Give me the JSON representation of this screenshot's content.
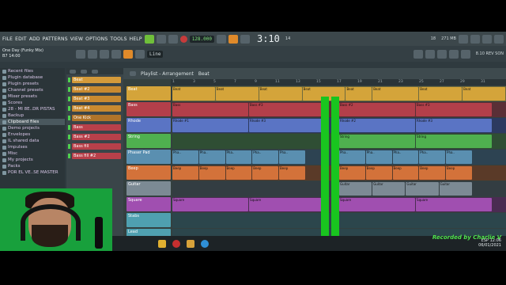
{
  "menu": [
    "FILE",
    "EDIT",
    "ADD",
    "PATTERNS",
    "VIEW",
    "OPTIONS",
    "TOOLS",
    "HELP"
  ],
  "transport": {
    "bpm": "128.000",
    "time": "3:10",
    "time_sub": "14",
    "cpu": "271 MB",
    "cpu2": "18"
  },
  "song": {
    "title": "One Day (Funky Mix)",
    "sub": "B7 14:00"
  },
  "toolbar": {
    "snap": "Line",
    "hint_label": "8.10 REV SON"
  },
  "browser": {
    "items": [
      {
        "label": "Recent files",
        "hl": false
      },
      {
        "label": "Plugin database",
        "hl": false
      },
      {
        "label": "Plugin presets",
        "hl": false
      },
      {
        "label": "Channel presets",
        "hl": false
      },
      {
        "label": "Mixer presets",
        "hl": false
      },
      {
        "label": "Scores",
        "hl": false
      },
      {
        "label": "28 - MI 8E..DR PISTAS",
        "hl": false
      },
      {
        "label": "Backup",
        "hl": false
      },
      {
        "label": "Clipboard files",
        "hl": true
      },
      {
        "label": "Demo projects",
        "hl": false
      },
      {
        "label": "Envelopes",
        "hl": false
      },
      {
        "label": "IL shared data",
        "hl": false
      },
      {
        "label": "Impulses",
        "hl": false
      },
      {
        "label": "Misc",
        "hl": false
      },
      {
        "label": "My projects",
        "hl": false
      },
      {
        "label": "Packs",
        "hl": false
      },
      {
        "label": "POR EL VE..SE MASTER",
        "hl": false
      }
    ]
  },
  "channels": [
    {
      "label": "Beat",
      "color": "#d49a3a"
    },
    {
      "label": "Beat #2",
      "color": "#c98a30"
    },
    {
      "label": "Beat #3",
      "color": "#c98a30"
    },
    {
      "label": "Beat #4",
      "color": "#c98a30"
    },
    {
      "label": "One Kick",
      "color": "#b0742a"
    },
    {
      "label": "Bass",
      "color": "#b8404a"
    },
    {
      "label": "Bass #2",
      "color": "#b8404a"
    },
    {
      "label": "Bass fill",
      "color": "#b8404a"
    },
    {
      "label": "Bass fill #2",
      "color": "#b8404a"
    }
  ],
  "playlist": {
    "title": "Playlist - Arrangement",
    "pattern": "Beat",
    "ruler": [
      "1",
      "3",
      "5",
      "7",
      "9",
      "11",
      "13",
      "15",
      "17",
      "19",
      "21",
      "23",
      "25",
      "27",
      "29",
      "31"
    ],
    "tracks": [
      {
        "label": "Beat",
        "color": "#d4a43a",
        "lane": "#6f6a3e",
        "clips": [
          [
            "Beat",
            0,
            13
          ],
          [
            "Beat",
            13,
            26
          ],
          [
            "Beat",
            26,
            39
          ],
          [
            "Beat",
            39,
            52
          ],
          [
            "Beat",
            52,
            60
          ],
          [
            "Beat",
            60,
            74
          ],
          [
            "Beat",
            74,
            87
          ],
          [
            "Beat",
            87,
            100
          ]
        ]
      },
      {
        "label": "Bass",
        "color": "#b33f4a",
        "lane": "#5a2f36",
        "clips": [
          [
            "Bass",
            0,
            23
          ],
          [
            "Bass #3",
            23,
            46
          ],
          [
            "Bass #2",
            50,
            73
          ],
          [
            "Bass #3",
            73,
            96
          ]
        ]
      },
      {
        "label": "Rhode",
        "color": "#5a74c4",
        "lane": "#2c3a60",
        "clips": [
          [
            "Rhode #1",
            0,
            23
          ],
          [
            "Rhode #3",
            23,
            46
          ],
          [
            "Rhode #2",
            50,
            73
          ],
          [
            "Rhode #3",
            73,
            96
          ]
        ]
      },
      {
        "label": "String",
        "color": "#4fb04f",
        "lane": "#2f4e34",
        "clips": [
          [
            "String",
            50,
            73
          ],
          [
            "String",
            73,
            96
          ]
        ]
      },
      {
        "label": "Phaser Pad",
        "color": "#5a8fb0",
        "lane": "#2d4352",
        "clips": [
          [
            "Pha..",
            0,
            8
          ],
          [
            "Pha..",
            8,
            16
          ],
          [
            "Pha..",
            16,
            24
          ],
          [
            "Pha..",
            24,
            32
          ],
          [
            "Pha..",
            32,
            40
          ],
          [
            "Pha..",
            50,
            58
          ],
          [
            "Pha..",
            58,
            66
          ],
          [
            "Pha..",
            66,
            74
          ],
          [
            "Pha..",
            74,
            82
          ],
          [
            "Pha..",
            82,
            90
          ]
        ]
      },
      {
        "label": "Beep",
        "color": "#d3723a",
        "lane": "#5a3a28",
        "clips": [
          [
            "Beep",
            0,
            8
          ],
          [
            "Beep",
            8,
            16
          ],
          [
            "Beep",
            16,
            24
          ],
          [
            "Beep",
            24,
            32
          ],
          [
            "Beep",
            32,
            40
          ],
          [
            "Beep",
            50,
            58
          ],
          [
            "Beep",
            58,
            66
          ],
          [
            "Beep",
            66,
            74
          ],
          [
            "Beep",
            74,
            82
          ],
          [
            "Beep",
            82,
            90
          ]
        ]
      },
      {
        "label": "Guitar",
        "color": "#7c8a94",
        "lane": "#333d42",
        "clips": [
          [
            "Guitar",
            50,
            60
          ],
          [
            "Guitar",
            60,
            70
          ],
          [
            "Guitar",
            70,
            80
          ],
          [
            "Guitar",
            80,
            90
          ]
        ]
      },
      {
        "label": "Square",
        "color": "#a04fb0",
        "lane": "#4a2c52",
        "clips": [
          [
            "Square",
            0,
            23
          ],
          [
            "Square",
            23,
            46
          ],
          [
            "Square",
            50,
            73
          ],
          [
            "Square",
            73,
            96
          ]
        ]
      },
      {
        "label": "Stabs",
        "color": "#4fa0b0",
        "lane": "#2c464c",
        "clips": []
      },
      {
        "label": "Lead",
        "color": "#4fa0b0",
        "lane": "#2c464c",
        "clips": []
      }
    ]
  },
  "taskbar": {
    "lang": "ESP",
    "time": "12:06",
    "date": "06/01/2021"
  },
  "watermark": "Recorded by Charlie V"
}
